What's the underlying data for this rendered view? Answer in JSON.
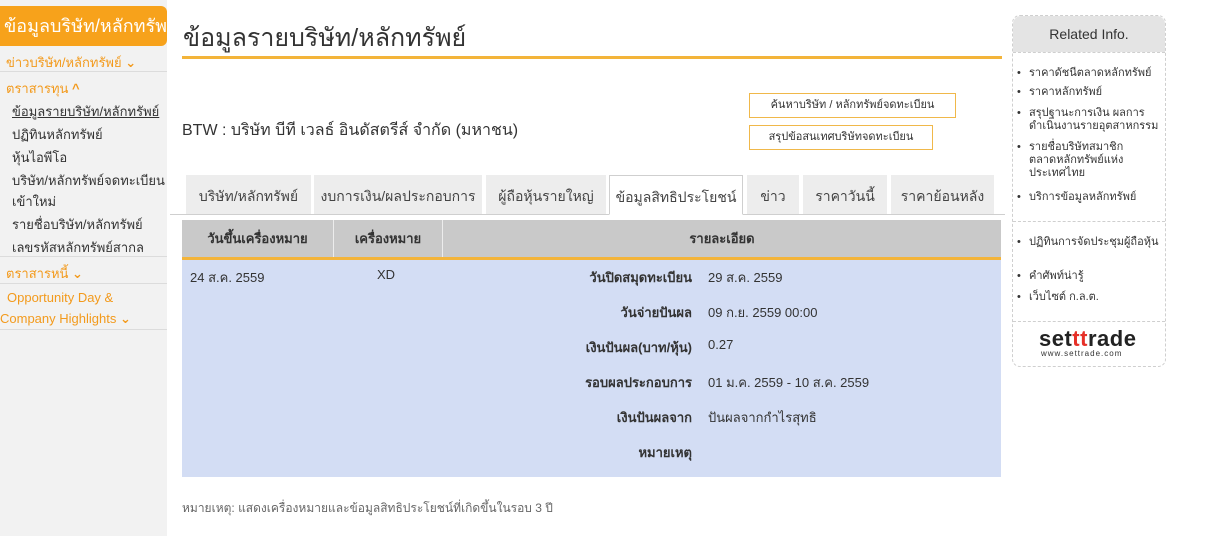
{
  "sidebar": {
    "title": "ข้อมูลบริษัท/หลักทรัพย์",
    "news": "ข่าวบริษัท/หลักทรัพย์",
    "equity": "ตราสารทุน",
    "equity_items": [
      "ข้อมูลรายบริษัท/หลักทรัพย์",
      "ปฏิทินหลักทรัพย์",
      "หุ้นไอพีโอ",
      "บริษัท/หลักทรัพย์จดทะเบียน",
      "เข้าใหม่",
      "รายชื่อบริษัท/หลักทรัพย์",
      "เลขรหัสหลักทรัพย์สากล"
    ],
    "debt": "ตราสารหนี้",
    "opp_line1": "Opportunity Day &",
    "opp_line2": "Company Highlights"
  },
  "icons": {
    "chevron_down": "⌄",
    "chevron_up": "^"
  },
  "main": {
    "page_title": "ข้อมูลรายบริษัท/หลักทรัพย์",
    "company": "BTW : บริษัท บีที เวลธ์ อินดัสตรีส์ จำกัด (มหาชน)",
    "search_button": "ค้นหาบริษัท / หลักทรัพย์จดทะเบียน",
    "summary_button": "สรุปข้อสนเทศบริษัทจดทะเบียน",
    "tabs": [
      {
        "label": "บริษัท/หลักทรัพย์",
        "active": false
      },
      {
        "label": "งบการเงิน/ผลประกอบการ",
        "active": false
      },
      {
        "label": "ผู้ถือหุ้นรายใหญ่",
        "active": false
      },
      {
        "label": "ข้อมูลสิทธิประโยชน์",
        "active": true
      },
      {
        "label": "ข่าว",
        "active": false
      },
      {
        "label": "ราคาวันนี้",
        "active": false
      },
      {
        "label": "ราคาย้อนหลัง",
        "active": false
      }
    ],
    "table": {
      "headers": [
        "วันขึ้นเครื่องหมาย",
        "เครื่องหมาย",
        "รายละเอียด"
      ],
      "row": {
        "date": "24 ส.ค. 2559",
        "sign": "XD",
        "details": [
          {
            "label": "วันปิดสมุดทะเบียน",
            "value": "29 ส.ค. 2559"
          },
          {
            "label": "วันจ่ายปันผล",
            "value": "09 ก.ย. 2559 00:00"
          },
          {
            "label": "เงินปันผล(บาท/หุ้น)",
            "value": "0.27"
          },
          {
            "label": "รอบผลประกอบการ",
            "value": "01 ม.ค. 2559 - 10 ส.ค. 2559"
          },
          {
            "label": "เงินปันผลจาก",
            "value": "ปันผลจากกำไรสุทธิ"
          },
          {
            "label": "หมายเหตุ",
            "value": ""
          }
        ]
      }
    },
    "footnote": "หมายเหตุ: แสดงเครื่องหมายและข้อมูลสิทธิประโยชน์ที่เกิดขึ้นในรอบ 3 ปี"
  },
  "related": {
    "header": "Related Info.",
    "group1": [
      "ราคาดัชนีตลาดหลักทรัพย์",
      "ราคาหลักทรัพย์",
      "สรุปฐานะการเงิน ผลการดำเนินงานรายอุตสาหกรรม",
      "รายชื่อบริษัทสมาชิกตลาดหลักทรัพย์แห่งประเทศไทย",
      "บริการข้อมูลหลักทรัพย์"
    ],
    "group2": [
      "ปฏิทินการจัดประชุมผู้ถือหุ้น",
      "คำศัพท์น่ารู้",
      "เว็บไซต์ ก.ล.ต."
    ],
    "logo_a": "set",
    "logo_b": "tt",
    "logo_c": "rade",
    "logo_url": "www.settrade.com"
  }
}
